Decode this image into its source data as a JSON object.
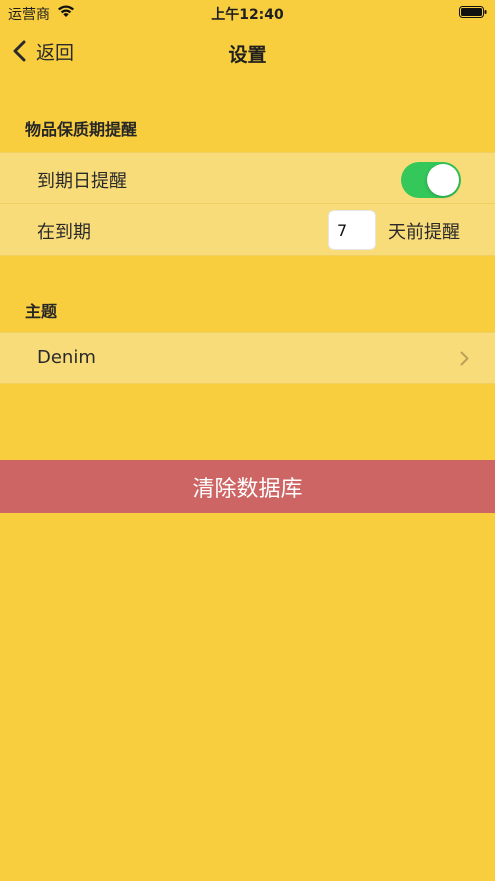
{
  "status_bar": {
    "carrier": "运营商",
    "time": "上午12:40"
  },
  "nav": {
    "back_label": "返回",
    "title": "设置"
  },
  "expiry_section": {
    "header": "物品保质期提醒",
    "due_reminder_label": "到期日提醒",
    "due_reminder_enabled": true,
    "before_label": "在到期",
    "days_value": "7",
    "days_suffix": "天前提醒"
  },
  "theme_section": {
    "header": "主题",
    "current_theme": "Denim"
  },
  "actions": {
    "clear_db_label": "清除数据库"
  },
  "colors": {
    "background": "#F8CE3F",
    "row_background": "#F9DC7A",
    "toggle_on": "#34C759",
    "danger": "#CE6565"
  }
}
